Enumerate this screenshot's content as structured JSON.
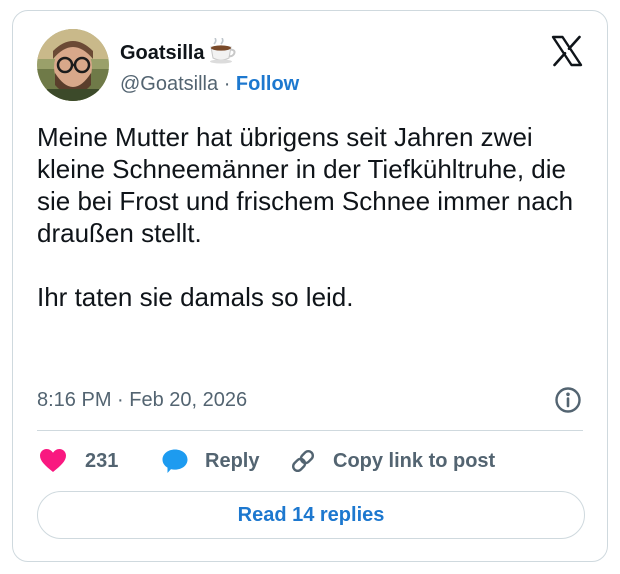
{
  "author": {
    "display_name": "Goatsilla",
    "handle": "@Goatsilla",
    "separator": "·",
    "follow_label": "Follow",
    "name_emoji": "coffee-cup-icon"
  },
  "tweet": {
    "text": "Meine Mutter hat übrigens seit Jahren zwei kleine Schneemänner in der Tiefkühltruhe, die sie bei Frost und frischem Schnee immer nach draußen stellt.\n\nIhr taten sie damals so leid.",
    "timestamp": "8:16 PM · Feb 20, 2026"
  },
  "actions": {
    "like_count": "231",
    "reply_label": "Reply",
    "copy_link_label": "Copy link to post"
  },
  "read_replies_label": "Read 14 replies",
  "icons": [
    "x-logo-icon",
    "info-icon",
    "heart-icon",
    "reply-bubble-icon",
    "link-icon"
  ],
  "colors": {
    "text": "#0f1419",
    "secondary": "#536471",
    "link": "#1d78cf",
    "heart": "#f91880",
    "reply": "#1d9bf0",
    "border": "#cfd9de"
  }
}
